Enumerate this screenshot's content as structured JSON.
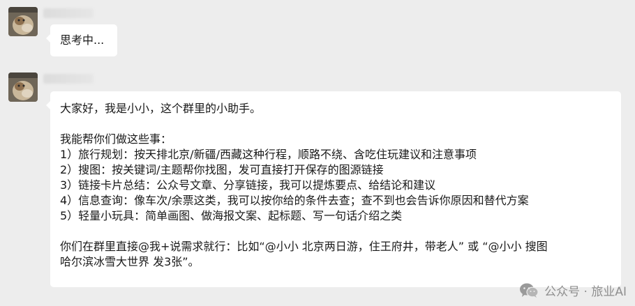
{
  "messages": [
    {
      "text": "思考中..."
    },
    {
      "lines": [
        "大家好，我是小小，这个群里的小助手。",
        "",
        "我能帮你们做这些事：",
        "1）旅行规划：按天排北京/新疆/西藏这种行程，顺路不绕、含吃住玩建议和注意事项",
        "2）搜图：按关键词/主题帮你找图，发可直接打开保存的图源链接",
        "3）链接卡片总结：公众号文章、分享链接，我可以提炼要点、给结论和建议",
        "4）信息查询：像车次/余票这类，我可以按你给的条件去查；查不到也会告诉你原因和替代方案",
        "5）轻量小玩具：简单画图、做海报文案、起标题、写一句话介绍之类",
        "",
        "你们在群里直接@我+说需求就行：比如“@小小 北京两日游，住王府井，带老人” 或 “@小小 搜图",
        "哈尔滨冰雪大世界 发3张”。"
      ]
    }
  ],
  "watermark": {
    "text": "公众号 · 旅业AI",
    "icon": "wechat-icon"
  }
}
